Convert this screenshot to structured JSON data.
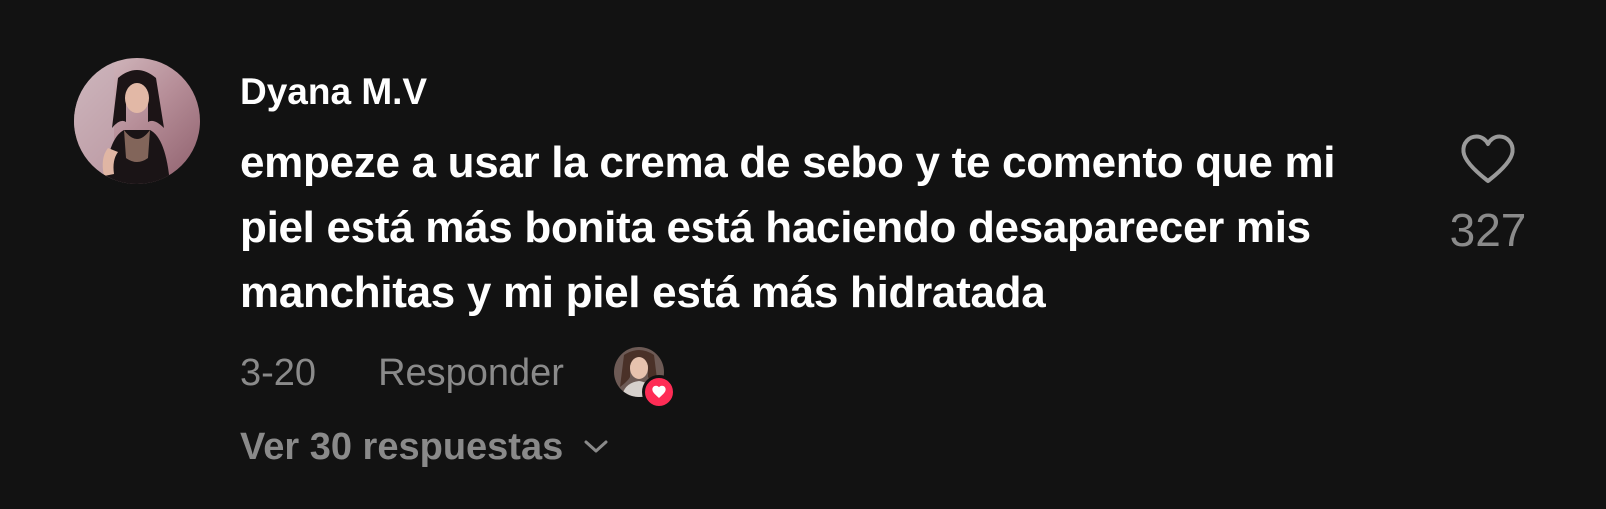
{
  "comment": {
    "username": "Dyana M.V",
    "text": "empeze a usar la crema de sebo y te comento que mi piel está más bonita está haciendo desaparecer mis manchitas y mi piel está más hidratada",
    "date": "3-20",
    "reply_label": "Responder",
    "view_replies_label": "Ver 30 respuestas",
    "like_count": "327",
    "liked_by_creator": true
  },
  "icons": {
    "like": "heart-outline-icon",
    "creator_badge": "heart-filled-icon",
    "expand": "chevron-down-icon"
  },
  "colors": {
    "background": "#121212",
    "text_primary": "#ffffff",
    "text_secondary": "#8a8a8a",
    "accent": "#fe2c55"
  }
}
